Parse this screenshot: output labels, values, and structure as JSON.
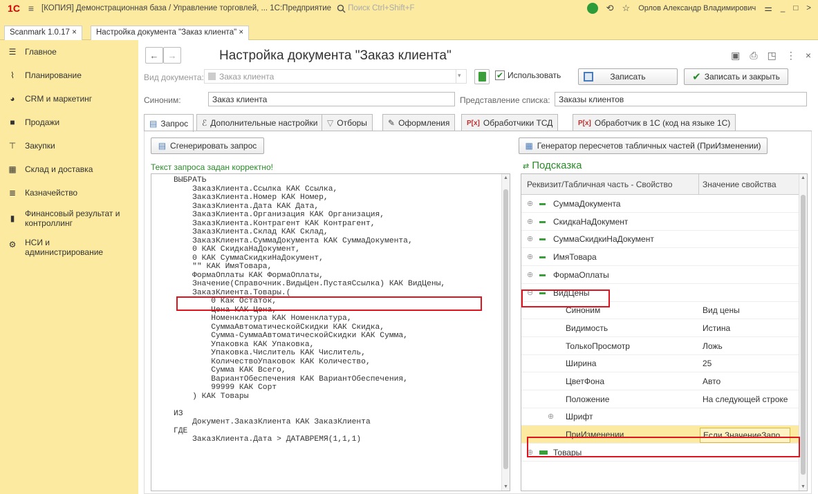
{
  "titlebar": {
    "logo": "1С",
    "title": "[КОПИЯ] Демонстрационная база / Управление торговлей, ...  1С:Предприятие",
    "search_placeholder": "Поиск Ctrl+Shift+F",
    "user": "Орлов Александр Владимирович"
  },
  "window_tabs": [
    {
      "label": "Scanmark 1.0.17 ×"
    },
    {
      "label": "Настройка документа \"Заказ клиента\" ×"
    }
  ],
  "sidebar": {
    "items": [
      {
        "label": "Главное",
        "icon": "menu-icon"
      },
      {
        "label": "Планирование",
        "icon": "chart-icon"
      },
      {
        "label": "CRM и маркетинг",
        "icon": "pie-icon"
      },
      {
        "label": "Продажи",
        "icon": "bag-icon"
      },
      {
        "label": "Закупки",
        "icon": "cart-icon"
      },
      {
        "label": "Склад и доставка",
        "icon": "grid-icon"
      },
      {
        "label": "Казначейство",
        "icon": "coins-icon"
      },
      {
        "label": "Финансовый результат и контроллинг",
        "icon": "bars-icon"
      },
      {
        "label": "НСИ и администрирование",
        "icon": "gear-icon"
      }
    ]
  },
  "header": {
    "title": "Настройка документа \"Заказ клиента\""
  },
  "form": {
    "doc_type_label": "Вид документа:",
    "doc_type_value": "Заказ клиента",
    "use_label": "Использовать",
    "save_label": "Записать",
    "save_close_label": "Записать и закрыть",
    "synonym_label": "Синоним:",
    "synonym_value": "Заказ клиента",
    "list_view_label": "Представление списка:",
    "list_view_value": "Заказы клиентов"
  },
  "tabs": [
    {
      "label": "Запрос"
    },
    {
      "label": "Дополнительные настройки"
    },
    {
      "label": "Отборы"
    },
    {
      "label": "Оформления"
    },
    {
      "label": "Обработчики ТСД"
    },
    {
      "label": "Обработчик в 1С (код на языке 1С)"
    }
  ],
  "query": {
    "generate_label": "Сгенерировать запрос",
    "status": "Текст запроса задан корректно!",
    "lines": [
      "ВЫБРАТЬ",
      "    ЗаказКлиента.Ссылка КАК Ссылка,",
      "    ЗаказКлиента.Номер КАК Номер,",
      "    ЗаказКлиента.Дата КАК Дата,",
      "    ЗаказКлиента.Организация КАК Организация,",
      "    ЗаказКлиента.Контрагент КАК Контрагент,",
      "    ЗаказКлиента.Склад КАК Склад,",
      "    ЗаказКлиента.СуммаДокумента КАК СуммаДокумента,",
      "    0 КАК СкидкаНаДокумент,",
      "    0 КАК СуммаСкидкиНаДокумент,",
      "    \"\" КАК ИмяТовара,",
      "    ФормаОплаты КАК ФормаОплаты,",
      "    Значение(Справочник.ВидыЦен.ПустаяСсылка) КАК ВидЦены,",
      "    ЗаказКлиента.Товары.(",
      "        0 Как Остаток,",
      "        Цена КАК Цена,",
      "        Номенклатура КАК Номенклатура,",
      "        СуммаАвтоматическойСкидки КАК Скидка,",
      "        Сумма-СуммаАвтоматическойСкидки КАК Сумма,",
      "        Упаковка КАК Упаковка,",
      "        Упаковка.Числитель КАК Числитель,",
      "        КоличествоУпаковок КАК Количество,",
      "        Сумма КАК Всего,",
      "        ВариантОбеспечения КАК ВариантОбеспечения,",
      "        99999 КАК Сорт",
      "    ) КАК Товары",
      "",
      "ИЗ",
      "    Документ.ЗаказКлиента КАК ЗаказКлиента",
      "ГДЕ",
      "    ЗаказКлиента.Дата > ДАТАВРЕМЯ(1,1,1)"
    ]
  },
  "right": {
    "generator_label": "Генератор пересчетов табличных частей (ПриИзменении)",
    "hint_title": "Подсказка",
    "col_property": "Реквизит/Табличная часть - Свойство",
    "col_value": "Значение свойства",
    "rows": [
      {
        "name": "СуммаДокумента",
        "value": ""
      },
      {
        "name": "СкидкаНаДокумент",
        "value": ""
      },
      {
        "name": "СуммаСкидкиНаДокумент",
        "value": ""
      },
      {
        "name": "ИмяТовара",
        "value": ""
      },
      {
        "name": "ФормаОплаты",
        "value": ""
      },
      {
        "name": "ВидЦены",
        "value": ""
      },
      {
        "name": "Синоним",
        "value": "Вид цены"
      },
      {
        "name": "Видимость",
        "value": "Истина"
      },
      {
        "name": "ТолькоПросмотр",
        "value": "Ложь"
      },
      {
        "name": "Ширина",
        "value": "25"
      },
      {
        "name": "ЦветФона",
        "value": "Авто"
      },
      {
        "name": "Положение",
        "value": "На следующей строке"
      },
      {
        "name": "Шрифт",
        "value": ""
      },
      {
        "name": "ПриИзменении",
        "value": "Если ЗначениеЗапо..."
      },
      {
        "name": "Товары",
        "value": ""
      }
    ]
  }
}
